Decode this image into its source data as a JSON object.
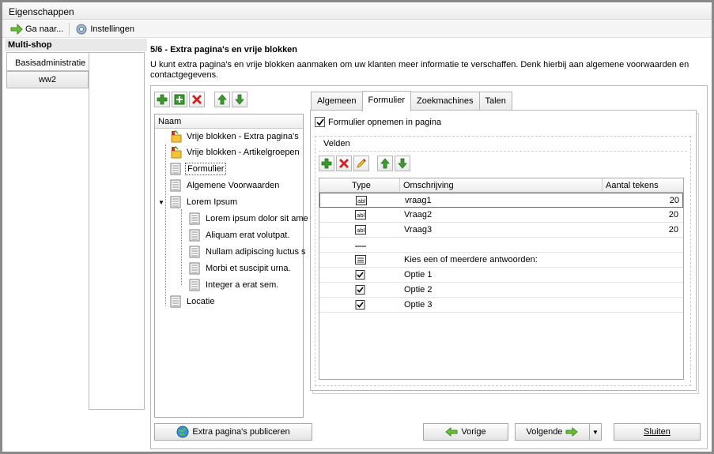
{
  "window": {
    "title": "Eigenschappen"
  },
  "toolbar": {
    "goto_label": "Ga naar...",
    "settings_label": "Instellingen"
  },
  "left": {
    "header": "Multi-shop",
    "tab_label": "Basisadministratie",
    "item_label": "ww2"
  },
  "step": {
    "title": "5/6 - Extra pagina's en vrije blokken",
    "description": "U kunt extra pagina's en vrije blokken aanmaken om uw klanten meer informatie te verschaffen. Denk hierbij aan algemene voorwaarden en contactgegevens."
  },
  "tree": {
    "header": "Naam",
    "items": [
      {
        "label": "Vrije blokken - Extra pagina's",
        "icon": "folder-block-icon"
      },
      {
        "label": "Vrije blokken - Artikelgroepen",
        "icon": "folder-block-icon"
      },
      {
        "label": "Formulier",
        "icon": "page-icon"
      },
      {
        "label": "Algemene Voorwaarden",
        "icon": "page-icon"
      },
      {
        "label": "Lorem Ipsum",
        "icon": "page-icon"
      },
      {
        "label": "Lorem ipsum dolor sit ame",
        "icon": "page-icon"
      },
      {
        "label": "Aliquam erat volutpat.",
        "icon": "page-icon"
      },
      {
        "label": "Nullam adipiscing luctus s",
        "icon": "page-icon"
      },
      {
        "label": "Morbi et suscipit urna.",
        "icon": "page-icon"
      },
      {
        "label": "Integer a erat sem.",
        "icon": "page-icon"
      },
      {
        "label": "Locatie",
        "icon": "page-icon"
      }
    ]
  },
  "tabs": [
    "Algemeen",
    "Formulier",
    "Zoekmachines",
    "Talen"
  ],
  "form": {
    "checkbox_label": "Formulier opnemen in pagina",
    "checkbox_checked": true,
    "group_label": "Velden",
    "columns": [
      "Type",
      "Omschrijving",
      "Aantal tekens"
    ],
    "rows": [
      {
        "type": "textfield-icon",
        "desc": "vraag1",
        "count": "20"
      },
      {
        "type": "textfield-icon",
        "desc": "Vraag2",
        "count": "20"
      },
      {
        "type": "textfield-icon",
        "desc": "Vraag3",
        "count": "20"
      },
      {
        "type": "separator-icon",
        "desc": "",
        "count": ""
      },
      {
        "type": "label-icon",
        "desc": "Kies een of meerdere antwoorden:",
        "count": ""
      },
      {
        "type": "checkbox-icon",
        "desc": "Optie 1",
        "count": ""
      },
      {
        "type": "checkbox-icon",
        "desc": "Optie 2",
        "count": ""
      },
      {
        "type": "checkbox-icon",
        "desc": "Optie 3",
        "count": ""
      }
    ]
  },
  "buttons": {
    "publish": "Extra pagina's publiceren",
    "prev": "Vorige",
    "next": "Volgende",
    "close": "Sluiten"
  },
  "colors": {
    "add_green": "#3a9a2a",
    "delete_red": "#d42020",
    "arrow_green": "#3f9a2f"
  }
}
